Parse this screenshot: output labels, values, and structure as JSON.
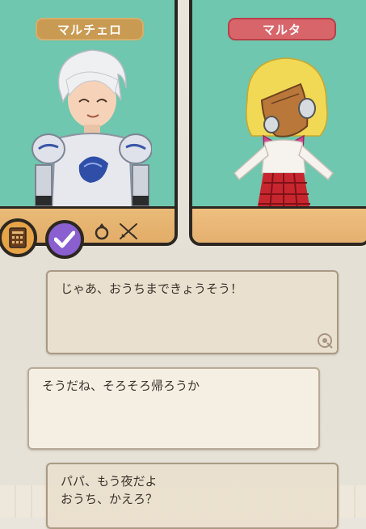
{
  "characters": {
    "left_name": "マルチェロ",
    "right_name": "マルタ"
  },
  "icons": [
    "journal-icon",
    "checkmark-icon",
    "ring-icon",
    "crossed-swords-icon"
  ],
  "dialogue": [
    {
      "text": "じゃあ、おうちまできょうそう！"
    },
    {
      "text": "そうだね、そろそろ帰ろうか"
    },
    {
      "line1": "パパ、もう夜だよ",
      "line2": "おうち、かえろ？"
    }
  ],
  "colors": {
    "backdrop": "#6ec7ae",
    "floor": "#e8b977",
    "left_tag": "#c99a52",
    "right_tag": "#d8656a"
  }
}
